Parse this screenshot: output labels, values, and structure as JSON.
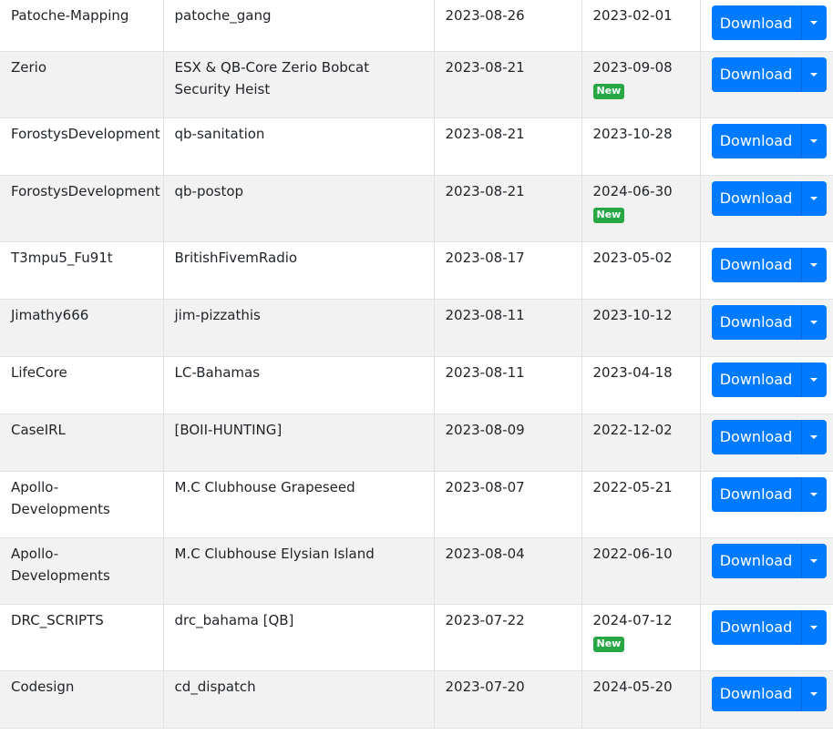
{
  "table": {
    "badge_label": "New",
    "download_label": "Download",
    "colors": {
      "button": "#007bff",
      "badge": "#28a745",
      "row_alt": "#f2f2f2",
      "border": "#dee2e6"
    },
    "rows": [
      {
        "author": "Patoche-Mapping",
        "name": "patoche_gang",
        "updated": "2023-08-26",
        "released": "2023-02-01",
        "is_new": false
      },
      {
        "author": "Zerio",
        "name": "ESX & QB-Core Zerio Bobcat Security Heist",
        "updated": "2023-08-21",
        "released": "2023-09-08",
        "is_new": true
      },
      {
        "author": "ForostysDevelopment",
        "name": "qb-sanitation",
        "updated": "2023-08-21",
        "released": "2023-10-28",
        "is_new": false
      },
      {
        "author": "ForostysDevelopment",
        "name": "qb-postop",
        "updated": "2023-08-21",
        "released": "2024-06-30",
        "is_new": true
      },
      {
        "author": "T3mpu5_Fu91t",
        "name": "BritishFivemRadio",
        "updated": "2023-08-17",
        "released": "2023-05-02",
        "is_new": false
      },
      {
        "author": "Jimathy666",
        "name": "jim-pizzathis",
        "updated": "2023-08-11",
        "released": "2023-10-12",
        "is_new": false
      },
      {
        "author": "LifeCore",
        "name": "LC-Bahamas",
        "updated": "2023-08-11",
        "released": "2023-04-18",
        "is_new": false
      },
      {
        "author": "CaseIRL",
        "name": "[BOII-HUNTING]",
        "updated": "2023-08-09",
        "released": "2022-12-02",
        "is_new": false
      },
      {
        "author": "Apollo-Developments",
        "name": "M.C Clubhouse Grapeseed",
        "updated": "2023-08-07",
        "released": "2022-05-21",
        "is_new": false
      },
      {
        "author": "Apollo-Developments",
        "name": "M.C Clubhouse Elysian Island",
        "updated": "2023-08-04",
        "released": "2022-06-10",
        "is_new": false
      },
      {
        "author": "DRC_SCRIPTS",
        "name": "drc_bahama [QB]",
        "updated": "2023-07-22",
        "released": "2024-07-12",
        "is_new": true
      },
      {
        "author": "Codesign",
        "name": "cd_dispatch",
        "updated": "2023-07-20",
        "released": "2024-05-20",
        "is_new": false
      }
    ]
  }
}
